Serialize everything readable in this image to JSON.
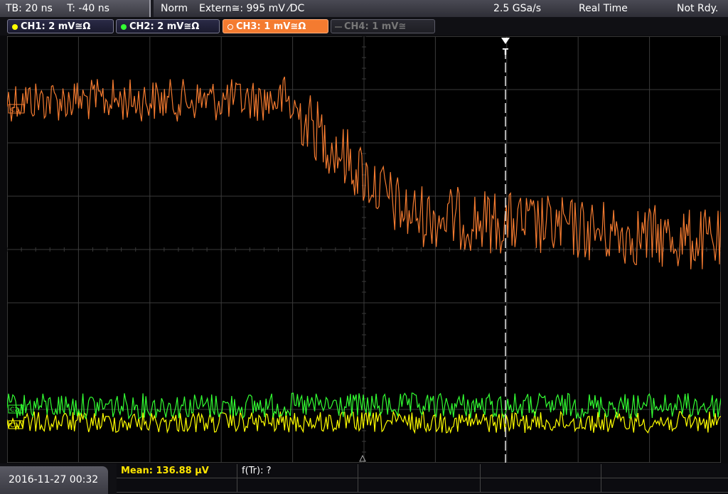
{
  "status_bar": {
    "timebase": "TB: 20 ns",
    "trigger_time": "T: -40 ns",
    "mode": "Norm",
    "trigger": "Extern≅: 995 mV ⁄DC",
    "sample_rate": "2.5 GSa/s",
    "acq_mode": "Real Time",
    "state": "Not Rdy."
  },
  "channels": [
    {
      "label": "CH1: 2 mV≅Ω",
      "color": "#ffff00",
      "active": true
    },
    {
      "label": "CH2: 2 mV≅Ω",
      "color": "#33ff33",
      "active": true
    },
    {
      "label": "CH3: 1 mV≅Ω",
      "color": "#f47b30",
      "active": true,
      "selected": true
    },
    {
      "label": "CH4: 1 mV≅",
      "color": "#777777",
      "active": false
    }
  ],
  "markers": {
    "ch3": "C3",
    "ch2": "C2",
    "ch1": "C1",
    "trigger": "T"
  },
  "colors": {
    "ch1": "#ffff00",
    "ch2": "#33ff33",
    "ch3": "#f47b30",
    "grid": "#3a3a3a",
    "trigger_line": "#e8e8e8"
  },
  "bottom": {
    "datetime": "2016-11-27 00:32",
    "mean": "Mean: 136.88 µV",
    "ftr": "f(Tr): ?"
  }
}
